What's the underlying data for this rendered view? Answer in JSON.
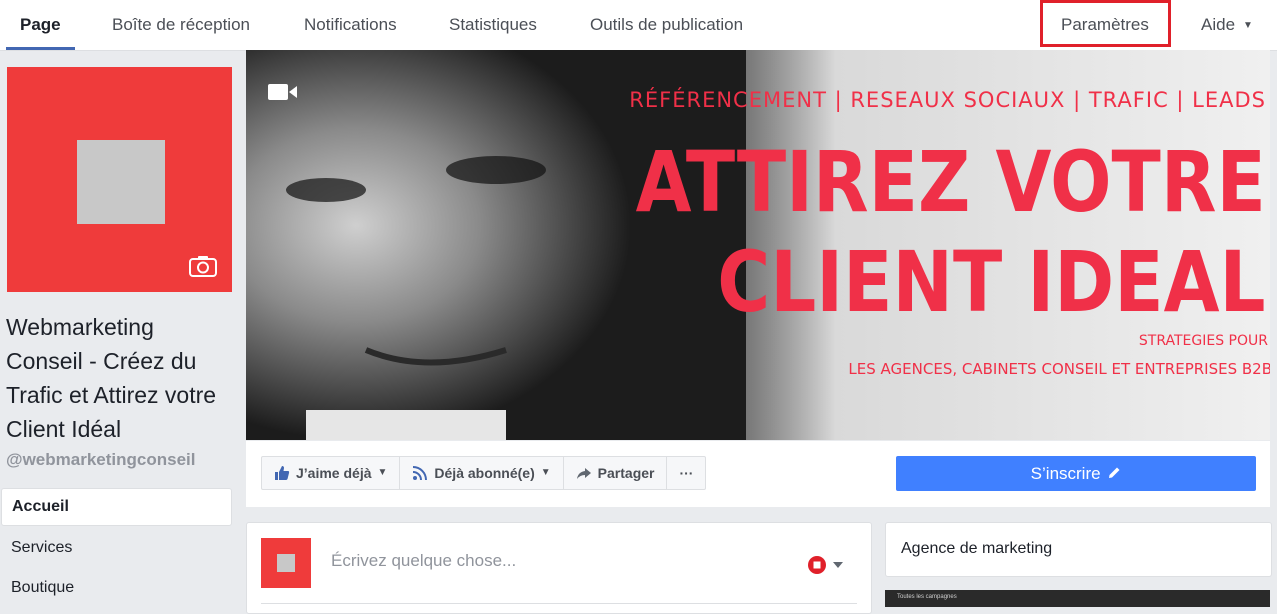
{
  "topnav": {
    "tabs": [
      {
        "label": "Page"
      },
      {
        "label": "Boîte de réception"
      },
      {
        "label": "Notifications"
      },
      {
        "label": "Statistiques"
      },
      {
        "label": "Outils de publication"
      },
      {
        "label": "Paramètres"
      },
      {
        "label": "Aide"
      }
    ]
  },
  "profile": {
    "name": "Webmarketing Conseil - Créez du Trafic et Attirez votre Client Idéal",
    "handle": "@webmarketingconseil"
  },
  "sidenav": {
    "items": [
      {
        "label": "Accueil"
      },
      {
        "label": "Services"
      },
      {
        "label": "Boutique"
      }
    ]
  },
  "cover": {
    "line1": "RÉFÉRENCEMENT | RESEAUX SOCIAUX | TRAFIC | LEADS",
    "line2": "ATTIREZ VOTRE",
    "line3": "CLIENT IDEAL",
    "line4": "STRATEGIES POUR",
    "line5": "LES AGENCES, CABINETS CONSEIL ET ENTREPRISES B2B"
  },
  "actions": {
    "like": "J’aime déjà",
    "follow": "Déjà abonné(e)",
    "share": "Partager",
    "more": "···",
    "subscribe": "S’inscrire"
  },
  "composer": {
    "placeholder": "Écrivez quelque chose..."
  },
  "right_card": {
    "title": "Agence de marketing",
    "thumb_text": "Toutes les campagnes"
  },
  "colors": {
    "brand_red": "#ef3b3b",
    "accent_blue": "#4080ff",
    "highlight": "#e0202a"
  }
}
